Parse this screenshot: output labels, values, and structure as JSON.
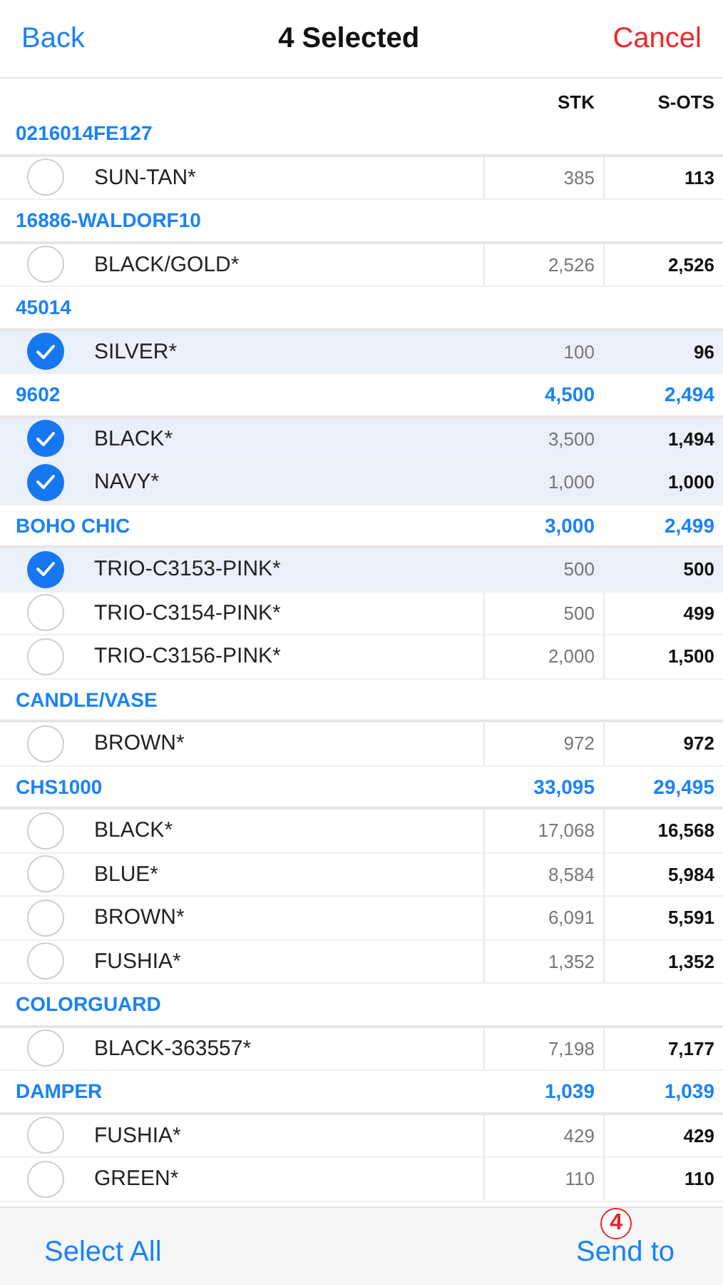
{
  "nav": {
    "back": "Back",
    "title": "4 Selected",
    "cancel": "Cancel"
  },
  "columns": [
    "STK",
    "S-OTS"
  ],
  "groups": [
    {
      "name": "0216014FE127",
      "items": [
        {
          "name": "SUN-TAN*",
          "stk": "385",
          "sots": "113",
          "selected": false
        }
      ]
    },
    {
      "name": "16886-WALDORF10",
      "items": [
        {
          "name": "BLACK/GOLD*",
          "stk": "2,526",
          "sots": "2,526",
          "selected": false
        }
      ]
    },
    {
      "name": "45014",
      "items": [
        {
          "name": "SILVER*",
          "stk": "100",
          "sots": "96",
          "selected": true
        }
      ]
    },
    {
      "name": "9602",
      "stk": "4,500",
      "sots": "2,494",
      "items": [
        {
          "name": "BLACK*",
          "stk": "3,500",
          "sots": "1,494",
          "selected": true
        },
        {
          "name": "NAVY*",
          "stk": "1,000",
          "sots": "1,000",
          "selected": true
        }
      ]
    },
    {
      "name": "BOHO CHIC",
      "stk": "3,000",
      "sots": "2,499",
      "items": [
        {
          "name": "TRIO-C3153-PINK*",
          "stk": "500",
          "sots": "500",
          "selected": true
        },
        {
          "name": "TRIO-C3154-PINK*",
          "stk": "500",
          "sots": "499",
          "selected": false
        },
        {
          "name": "TRIO-C3156-PINK*",
          "stk": "2,000",
          "sots": "1,500",
          "selected": false
        }
      ]
    },
    {
      "name": "CANDLE/VASE",
      "items": [
        {
          "name": "BROWN*",
          "stk": "972",
          "sots": "972",
          "selected": false
        }
      ]
    },
    {
      "name": "CHS1000",
      "stk": "33,095",
      "sots": "29,495",
      "items": [
        {
          "name": "BLACK*",
          "stk": "17,068",
          "sots": "16,568",
          "selected": false
        },
        {
          "name": "BLUE*",
          "stk": "8,584",
          "sots": "5,984",
          "selected": false
        },
        {
          "name": "BROWN*",
          "stk": "6,091",
          "sots": "5,591",
          "selected": false
        },
        {
          "name": "FUSHIA*",
          "stk": "1,352",
          "sots": "1,352",
          "selected": false
        }
      ]
    },
    {
      "name": "COLORGUARD",
      "items": [
        {
          "name": "BLACK-363557*",
          "stk": "7,198",
          "sots": "7,177",
          "selected": false
        }
      ]
    },
    {
      "name": "DAMPER",
      "stk": "1,039",
      "sots": "1,039",
      "items": [
        {
          "name": "FUSHIA*",
          "stk": "429",
          "sots": "429",
          "selected": false
        },
        {
          "name": "GREEN*",
          "stk": "110",
          "sots": "110",
          "selected": false
        }
      ]
    }
  ],
  "toolbar": {
    "select_all": "Select All",
    "send_to": "Send to",
    "badge": "4"
  }
}
